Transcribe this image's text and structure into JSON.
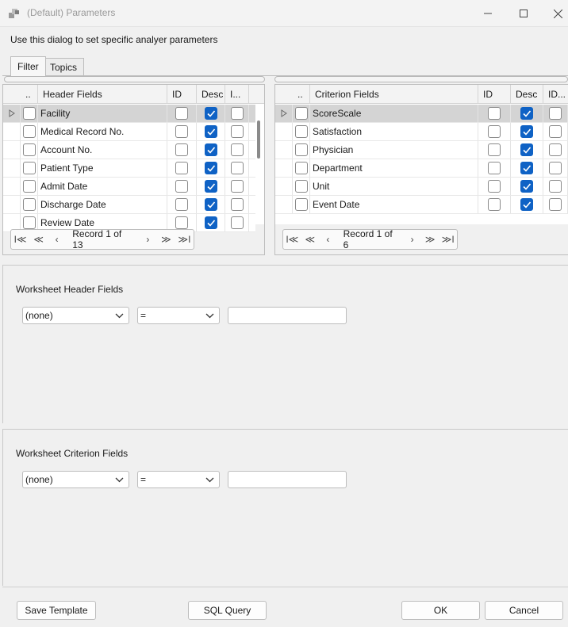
{
  "window": {
    "title": "(Default) Parameters",
    "minimize_glyph": "—",
    "maximize_glyph": "☐",
    "close_glyph": "✕"
  },
  "instruction": "Use this dialog to set specific analyer parameters",
  "tabs": [
    {
      "label": "Filter",
      "active": true
    },
    {
      "label": "Topics",
      "active": false
    }
  ],
  "header_grid": {
    "columns": [
      "..",
      "Header Fields",
      "ID",
      "Desc",
      "I..."
    ],
    "rows": [
      {
        "label": "Facility",
        "id": false,
        "desc": true,
        "i": false,
        "selected": true
      },
      {
        "label": "Medical Record No.",
        "id": false,
        "desc": true,
        "i": false
      },
      {
        "label": "Account No.",
        "id": false,
        "desc": true,
        "i": false
      },
      {
        "label": "Patient Type",
        "id": false,
        "desc": true,
        "i": false
      },
      {
        "label": "Admit Date",
        "id": false,
        "desc": true,
        "i": false
      },
      {
        "label": "Discharge Date",
        "id": false,
        "desc": true,
        "i": false
      },
      {
        "label": "Review Date",
        "id": false,
        "desc": true,
        "i": false
      }
    ],
    "navigator_text": "Record 1 of 13"
  },
  "criterion_grid": {
    "columns": [
      "..",
      "Criterion Fields",
      "ID",
      "Desc",
      "ID..."
    ],
    "rows": [
      {
        "label": "ScoreScale",
        "id": false,
        "desc": true,
        "i": false,
        "selected": true
      },
      {
        "label": "Satisfaction",
        "id": false,
        "desc": true,
        "i": false
      },
      {
        "label": "Physician",
        "id": false,
        "desc": true,
        "i": false
      },
      {
        "label": "Department",
        "id": false,
        "desc": true,
        "i": false
      },
      {
        "label": "Unit",
        "id": false,
        "desc": true,
        "i": false
      },
      {
        "label": "Event Date",
        "id": false,
        "desc": true,
        "i": false
      }
    ],
    "navigator_text": "Record 1 of 6"
  },
  "navigator_glyphs": {
    "first": "I≪",
    "prev_page": "≪",
    "prev": "‹",
    "next": "›",
    "next_page": "≫",
    "last": "≫I"
  },
  "worksheet_header": {
    "title": "Worksheet Header Fields",
    "field_value": "(none)",
    "operator_value": "=",
    "text_value": ""
  },
  "worksheet_criterion": {
    "title": "Worksheet Criterion Fields",
    "field_value": "(none)",
    "operator_value": "=",
    "text_value": ""
  },
  "buttons": {
    "save_template": "Save Template",
    "sql_query": "SQL Query",
    "ok": "OK",
    "cancel": "Cancel"
  },
  "colors": {
    "accent": "#0f62c5",
    "selected_row": "#d4d4d4",
    "background": "#f0f0f0"
  }
}
